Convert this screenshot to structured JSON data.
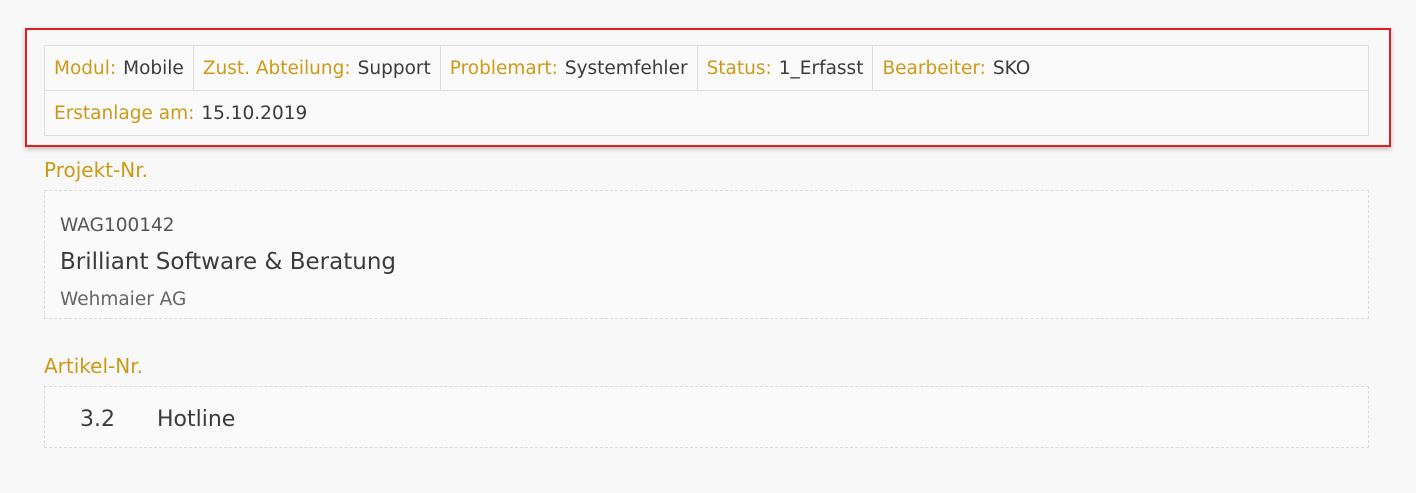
{
  "info": {
    "row1": [
      {
        "label": "Modul:",
        "value": "Mobile"
      },
      {
        "label": "Zust. Abteilung:",
        "value": "Support"
      },
      {
        "label": "Problemart:",
        "value": "Systemfehler"
      },
      {
        "label": "Status:",
        "value": "1_Erfasst"
      },
      {
        "label": "Bearbeiter:",
        "value": "SKO"
      }
    ],
    "row2": [
      {
        "label": "Erstanlage am:",
        "value": "15.10.2019"
      }
    ]
  },
  "project": {
    "title": "Projekt-Nr.",
    "number": "WAG100142",
    "name": "Brilliant Software & Beratung",
    "company": "Wehmaier AG"
  },
  "article": {
    "title": "Artikel-Nr.",
    "number": "3.2",
    "name": "Hotline"
  },
  "colors": {
    "label": "#cc9a16",
    "highlight_border": "#e11d1d"
  }
}
